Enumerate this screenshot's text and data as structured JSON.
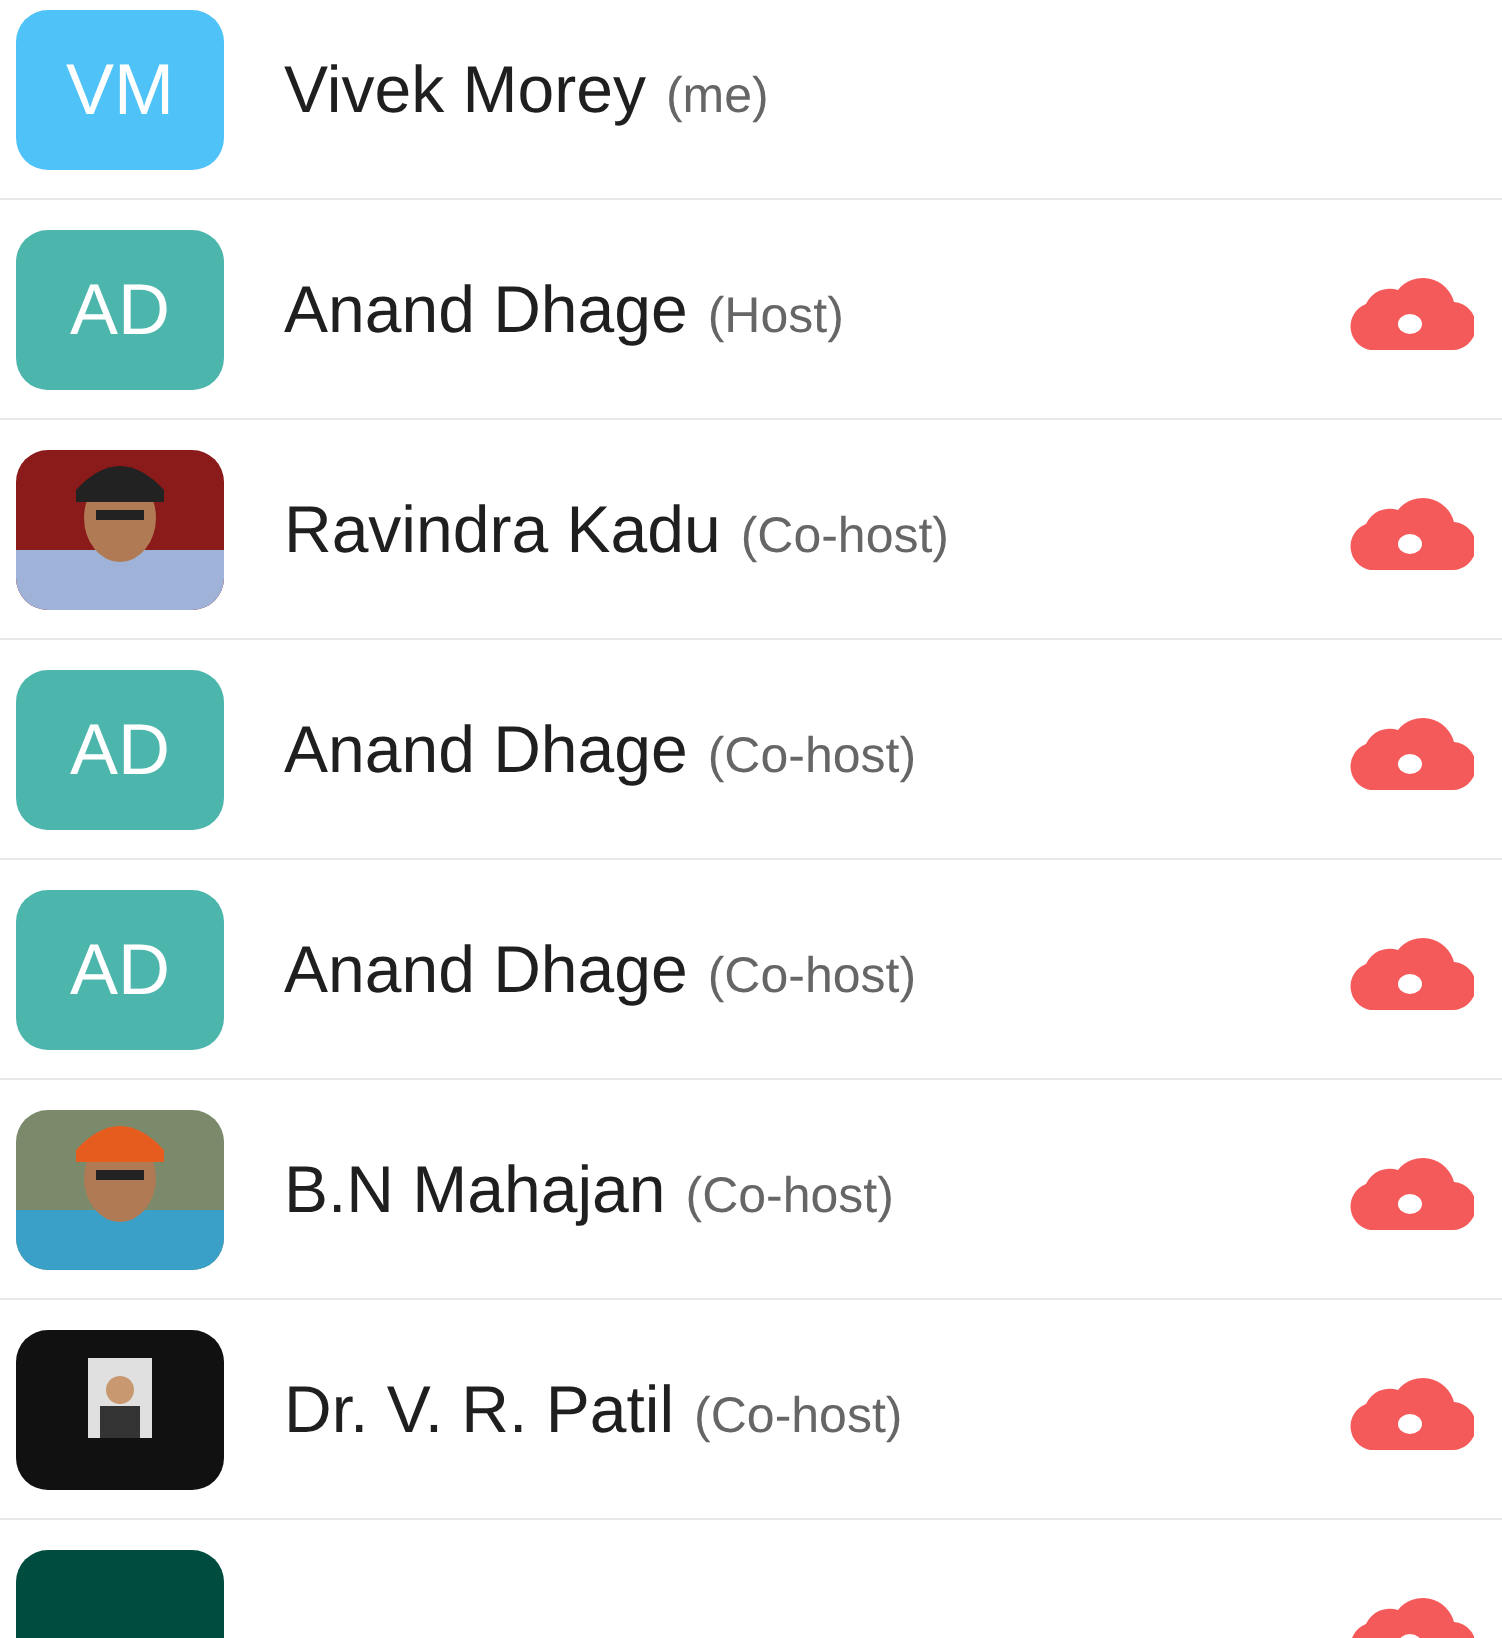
{
  "participants": [
    {
      "avatar": {
        "kind": "initials",
        "initials": "VM",
        "color": "#4fc3f7"
      },
      "name": "Vivek Morey",
      "role": "(me)",
      "cloud": false
    },
    {
      "avatar": {
        "kind": "initials",
        "initials": "AD",
        "color": "#4db6ac"
      },
      "name": "Anand Dhage",
      "role": "(Host)",
      "cloud": true
    },
    {
      "name": "Ravindra Kadu",
      "role": "(Co-host)",
      "cloud": true
    },
    {
      "avatar": {
        "kind": "initials",
        "initials": "AD",
        "color": "#4db6ac"
      },
      "name": "Anand Dhage",
      "role": "(Co-host)",
      "cloud": true
    },
    {
      "avatar": {
        "kind": "initials",
        "initials": "AD",
        "color": "#4db6ac"
      },
      "name": "Anand Dhage",
      "role": "(Co-host)",
      "cloud": true
    },
    {
      "name": "B.N Mahajan",
      "role": "(Co-host)",
      "cloud": true
    },
    {
      "name": "Dr. V. R. Patil",
      "role": "(Co-host)",
      "cloud": true
    },
    {
      "avatar": {
        "kind": "initials",
        "color": "#004d40"
      },
      "cloud": true
    }
  ]
}
